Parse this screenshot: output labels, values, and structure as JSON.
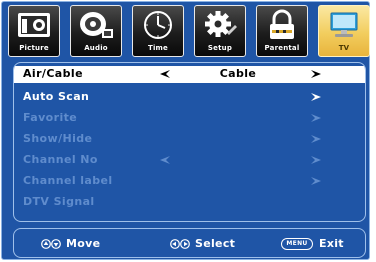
{
  "tabs": [
    {
      "label": "Picture",
      "icon": "picture-icon"
    },
    {
      "label": "Audio",
      "icon": "audio-icon"
    },
    {
      "label": "Time",
      "icon": "clock-icon"
    },
    {
      "label": "Setup",
      "icon": "gear-icon"
    },
    {
      "label": "Parental",
      "icon": "lock-icon"
    },
    {
      "label": "TV",
      "icon": "tv-icon",
      "active": true
    }
  ],
  "menu": {
    "items": [
      {
        "label": "Air/Cable",
        "value": "Cable"
      },
      {
        "label": "Auto Scan"
      },
      {
        "label": "Favorite"
      },
      {
        "label": "Show/Hide"
      },
      {
        "label": "Channel No"
      },
      {
        "label": "Channel label"
      },
      {
        "label": "DTV Signal"
      }
    ]
  },
  "footer": {
    "move_label": "Move",
    "select_label": "Select",
    "menu_key": "MENU",
    "exit_label": "Exit"
  },
  "colors": {
    "background": "#1f55a6",
    "border": "#9fc0ea",
    "dim_text": "#5f8ccd",
    "active_tab": "#f2cd5e"
  }
}
